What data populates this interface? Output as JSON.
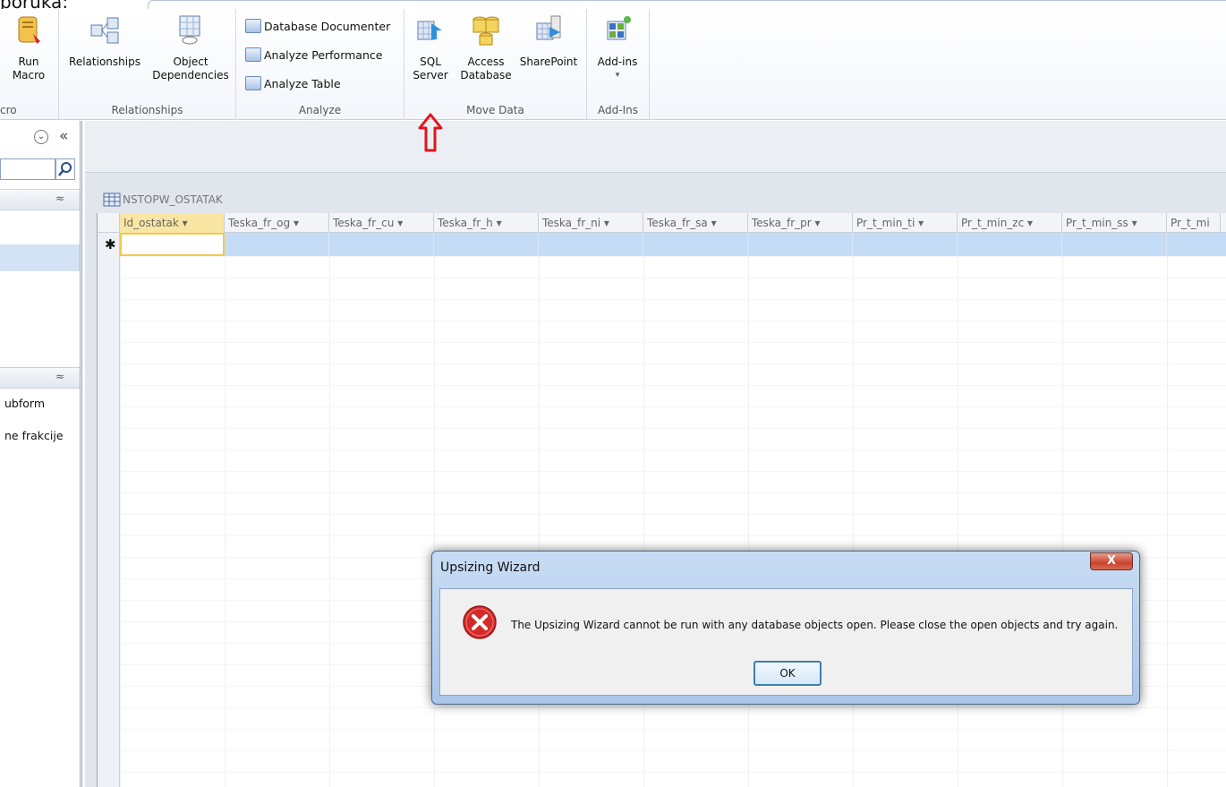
{
  "top_caption": "poruka:",
  "ribbon": {
    "groups": [
      {
        "label": "cro"
      },
      {
        "label": "Relationships"
      },
      {
        "label": "Analyze"
      },
      {
        "label": "Move Data"
      },
      {
        "label": "Add-Ins"
      }
    ],
    "run_macro": {
      "line1": "Run",
      "line2": "Macro"
    },
    "relationships": {
      "line1": "Relationships"
    },
    "object_dependencies": {
      "line1": "Object",
      "line2": "Dependencies"
    },
    "database_documenter": "Database Documenter",
    "analyze_performance": "Analyze Performance",
    "analyze_table": "Analyze Table",
    "sql_server": {
      "line1": "SQL",
      "line2": "Server"
    },
    "access_database": {
      "line1": "Access",
      "line2": "Database"
    },
    "sharepoint": {
      "line1": "SharePoint"
    },
    "addins": {
      "line1": "Add-ins",
      "line2": "▾"
    }
  },
  "nav": {
    "chevron": "⌄",
    "collapse": "«",
    "section_toggle_1": "≈",
    "section_toggle_2": "≈",
    "item_subform": "ubform",
    "item_frakcije": "ne frakcije"
  },
  "document": {
    "tab_title": "NSTOPW_OSTATAK",
    "columns": [
      "Id_ostatak ▾",
      "Teska_fr_og ▾",
      "Teska_fr_cu ▾",
      "Teska_fr_h ▾",
      "Teska_fr_ni ▾",
      "Teska_fr_sa ▾",
      "Teska_fr_pr ▾",
      "Pr_t_min_ti ▾",
      "Pr_t_min_zc ▾",
      "Pr_t_min_ss ▾",
      "Pr_t_mi"
    ],
    "new_row_marker": "✱"
  },
  "dialog": {
    "title": "Upsizing  Wizard",
    "close": "X",
    "message": "The Upsizing Wizard cannot be run with any database objects open. Please close the open objects and try again.",
    "ok_label": "OK"
  },
  "colors": {
    "accent_red": "#e0141c",
    "selection": "#c5dcf6",
    "active_header": "#f9e6a2"
  }
}
